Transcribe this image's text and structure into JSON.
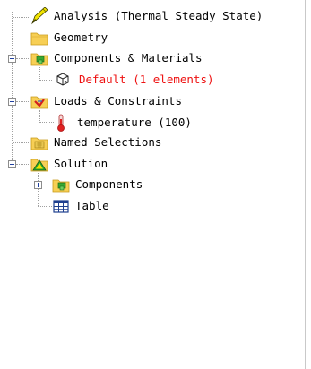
{
  "tree": {
    "analysis": {
      "label": "Analysis (Thermal Steady State)",
      "icon": "analysis-pen-icon"
    },
    "geometry": {
      "label": "Geometry",
      "icon": "folder-icon"
    },
    "components_materials": {
      "label": "Components & Materials",
      "icon": "components-folder-icon",
      "expanded": true
    },
    "default_material": {
      "label": "Default (1 elements)",
      "icon": "part-icon",
      "color": "#ee1111"
    },
    "loads_constraints": {
      "label": "Loads & Constraints",
      "icon": "loads-folder-icon",
      "expanded": true
    },
    "temperature": {
      "label": "temperature (100)",
      "icon": "thermometer-icon"
    },
    "named_selections": {
      "label": "Named Selections",
      "icon": "named-selections-icon"
    },
    "solution": {
      "label": "Solution",
      "icon": "solution-icon",
      "expanded": true
    },
    "solution_components": {
      "label": "Components",
      "icon": "components-folder-icon",
      "expanded": false
    },
    "table": {
      "label": "Table",
      "icon": "table-icon"
    }
  }
}
